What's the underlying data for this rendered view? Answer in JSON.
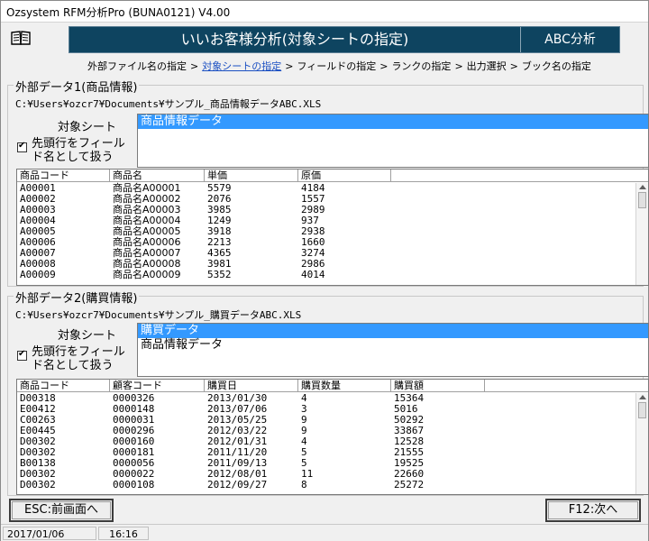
{
  "window": {
    "title": "Ozsystem RFM分析Pro (BUNA0121)   V4.00"
  },
  "header": {
    "title": "いいお客様分析(対象シートの指定)",
    "side_label": "ABC分析",
    "icon": "book-icon"
  },
  "breadcrumb": {
    "steps": [
      "外部ファイル名の指定",
      "対象シートの指定",
      "フィールドの指定",
      "ランクの指定",
      "出力選択",
      "ブック名の指定"
    ],
    "arrow": ">",
    "current_index": 1
  },
  "data1": {
    "legend": "外部データ1(商品情報)",
    "path": "C:¥Users¥ozcr7¥Documents¥サンプル_商品情報データABC.XLS",
    "sheet_label": "対象シート",
    "checkbox_label": "先頭行をフィールド名として扱う",
    "sheets": [
      "商品情報データ"
    ],
    "columns": [
      "商品コード",
      "商品名",
      "単価",
      "原価"
    ],
    "rows": [
      [
        "A00001",
        "商品名A00001",
        "5579",
        "4184"
      ],
      [
        "A00002",
        "商品名A00002",
        "2076",
        "1557"
      ],
      [
        "A00003",
        "商品名A00003",
        "3985",
        "2989"
      ],
      [
        "A00004",
        "商品名A00004",
        "1249",
        "937"
      ],
      [
        "A00005",
        "商品名A00005",
        "3918",
        "2938"
      ],
      [
        "A00006",
        "商品名A00006",
        "2213",
        "1660"
      ],
      [
        "A00007",
        "商品名A00007",
        "4365",
        "3274"
      ],
      [
        "A00008",
        "商品名A00008",
        "3981",
        "2986"
      ],
      [
        "A00009",
        "商品名A00009",
        "5352",
        "4014"
      ]
    ]
  },
  "data2": {
    "legend": "外部データ2(購買情報)",
    "path": "C:¥Users¥ozcr7¥Documents¥サンプル_購買データABC.XLS",
    "sheet_label": "対象シート",
    "checkbox_label": "先頭行をフィールド名として扱う",
    "sheets": [
      "購買データ",
      "商品情報データ"
    ],
    "columns": [
      "商品コード",
      "顧客コード",
      "購買日",
      "購買数量",
      "購買額"
    ],
    "rows": [
      [
        "D00318",
        "0000326",
        "2013/01/30",
        "4",
        "15364"
      ],
      [
        "E00412",
        "0000148",
        "2013/07/06",
        "3",
        "5016"
      ],
      [
        "C00263",
        "0000031",
        "2013/05/25",
        "9",
        "50292"
      ],
      [
        "E00445",
        "0000296",
        "2012/03/22",
        "9",
        "33867"
      ],
      [
        "D00302",
        "0000160",
        "2012/01/31",
        "4",
        "12528"
      ],
      [
        "D00302",
        "0000181",
        "2011/11/20",
        "5",
        "21555"
      ],
      [
        "B00138",
        "0000056",
        "2011/09/13",
        "5",
        "19525"
      ],
      [
        "D00302",
        "0000022",
        "2012/08/01",
        "11",
        "22660"
      ],
      [
        "D00302",
        "0000108",
        "2012/09/27",
        "8",
        "25272"
      ]
    ]
  },
  "buttons": {
    "back": "ESC:前画面へ",
    "next": "F12:次へ"
  },
  "status": {
    "date": "2017/01/06",
    "time": "16:16"
  },
  "colors": {
    "banner": "#0e4460",
    "selection": "#3399ff",
    "current_step": "#1a4fc2"
  }
}
